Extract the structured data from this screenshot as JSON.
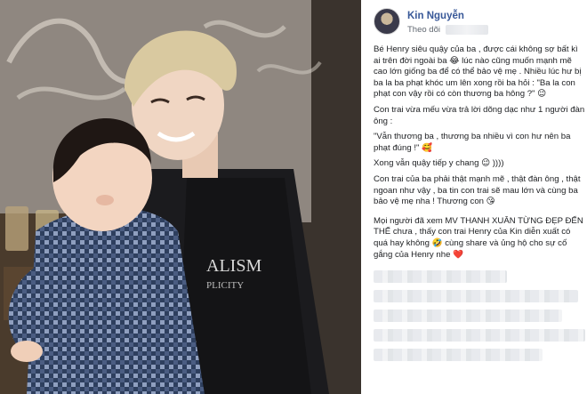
{
  "author": {
    "name": "Kin Nguyễn",
    "follow_label": "Theo dõi"
  },
  "post": {
    "paragraph_1": "Bé Henry siêu quậy của ba , được cái không sợ bất kì ai trên đời ngoài ba 😂 lúc nào cũng muốn mạnh mẽ cao lớn giống ba để có thể bảo vệ mẹ . Nhiều lúc hư bị ba la ba phạt khóc um lên xong rồi ba hỏi : \"Ba la con phạt con vậy rồi có còn thương ba hông ?\" 😉",
    "paragraph_2": "Con trai vừa mếu vừa trả lời dõng dạc như 1 người đàn ông :",
    "paragraph_3": "\"Vẫn thương ba , thương ba nhiều vì con hư nên ba phạt đúng !\" 🥰",
    "paragraph_4": "Xong vẫn quậy tiếp y chang 😉 ))))",
    "paragraph_5": "Con trai của ba phải thật mạnh mẽ , thật đàn ông , thật ngoan như vậy , ba tin con trai sẽ mau lớn và cùng ba bảo vệ mẹ nha ! Thương con 😘",
    "paragraph_6_main": "Mọi người đã xem MV THANH XUÂN TỪNG ĐẸP ĐẾN THẾ chưa , thấy con trai Henry của Kin diễn xuất có quá hay không 🤣 cùng share và ủng hộ cho sự cố gắng của Henry nhe",
    "paragraph_6_heart": "❤️"
  },
  "icons": {
    "avatar": "profile-avatar",
    "heart": "heart-emoji"
  },
  "photo_shirt_text": {
    "line_1": "ALISM",
    "line_2": "PLICITY"
  }
}
